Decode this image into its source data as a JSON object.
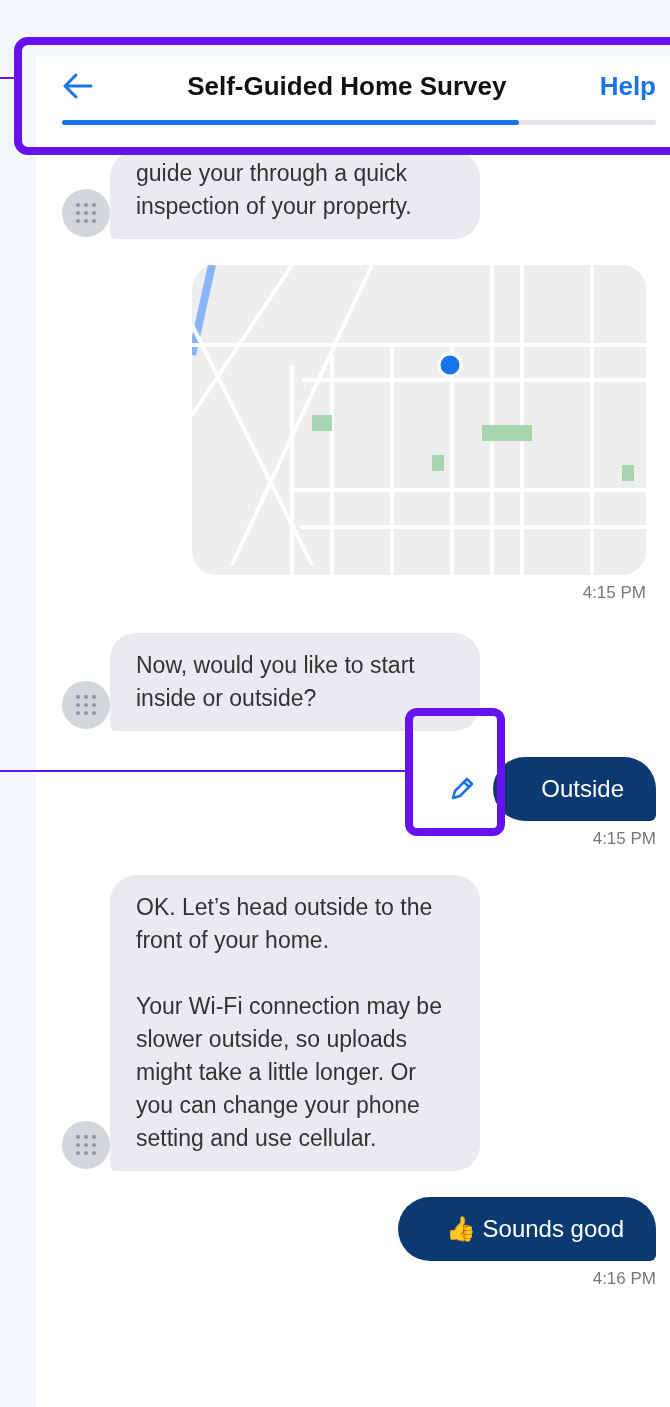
{
  "header": {
    "title": "Self-Guided Home Survey",
    "help": "Help"
  },
  "progress": {
    "level": 0.77
  },
  "messages": [
    {
      "kind": "bot",
      "paragraphs": [
        "guide your through a quick inspection of your property."
      ]
    },
    {
      "kind": "map",
      "time": "4:15 PM"
    },
    {
      "kind": "bot",
      "paragraphs": [
        "Now, would you like to start inside or outside?"
      ]
    },
    {
      "kind": "user",
      "text": "Outside",
      "editable": true,
      "time": "4:15 PM"
    },
    {
      "kind": "bot",
      "paragraphs": [
        "OK. Let’s head outside to the front of your home.",
        "Your Wi-Fi connection may be slower outside, so uploads might take a little longer. Or you can change your phone setting and use cellular."
      ]
    },
    {
      "kind": "user",
      "text": "👍 Sounds good",
      "editable": false,
      "time": "4:16 PM"
    }
  ]
}
